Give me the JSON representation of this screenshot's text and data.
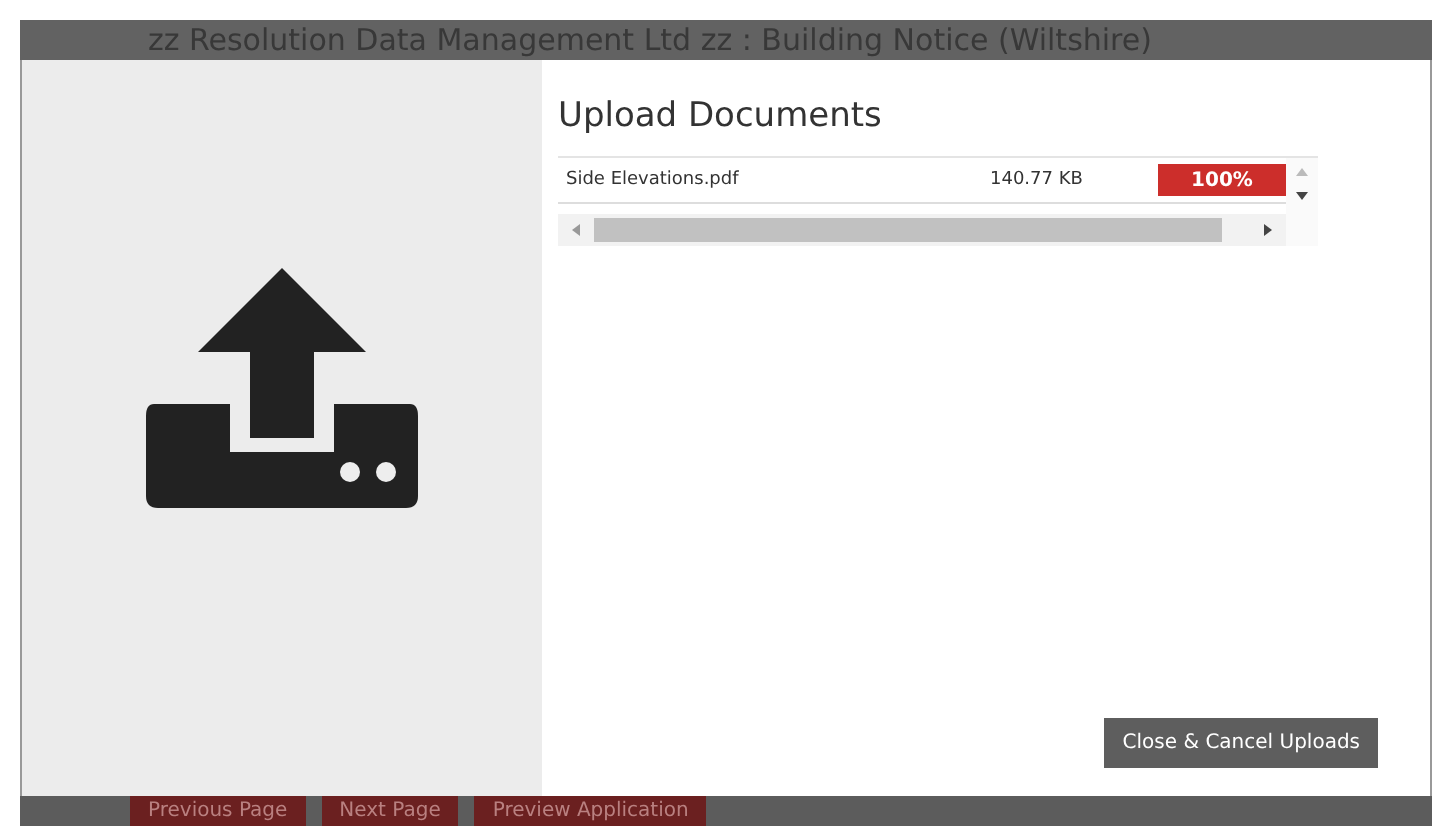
{
  "window": {
    "title": "zz Resolution Data Management Ltd zz : Building Notice (Wiltshire)"
  },
  "dialog": {
    "title": "Upload Documents",
    "files": [
      {
        "name": "Side Elevations.pdf",
        "size": "140.77 KB",
        "level": 1.0,
        "reading": "100%"
      }
    ],
    "close_button": "Close & Cancel Uploads"
  },
  "footer_buttons": [
    "Previous Page",
    "Next Page",
    "Preview Application"
  ]
}
